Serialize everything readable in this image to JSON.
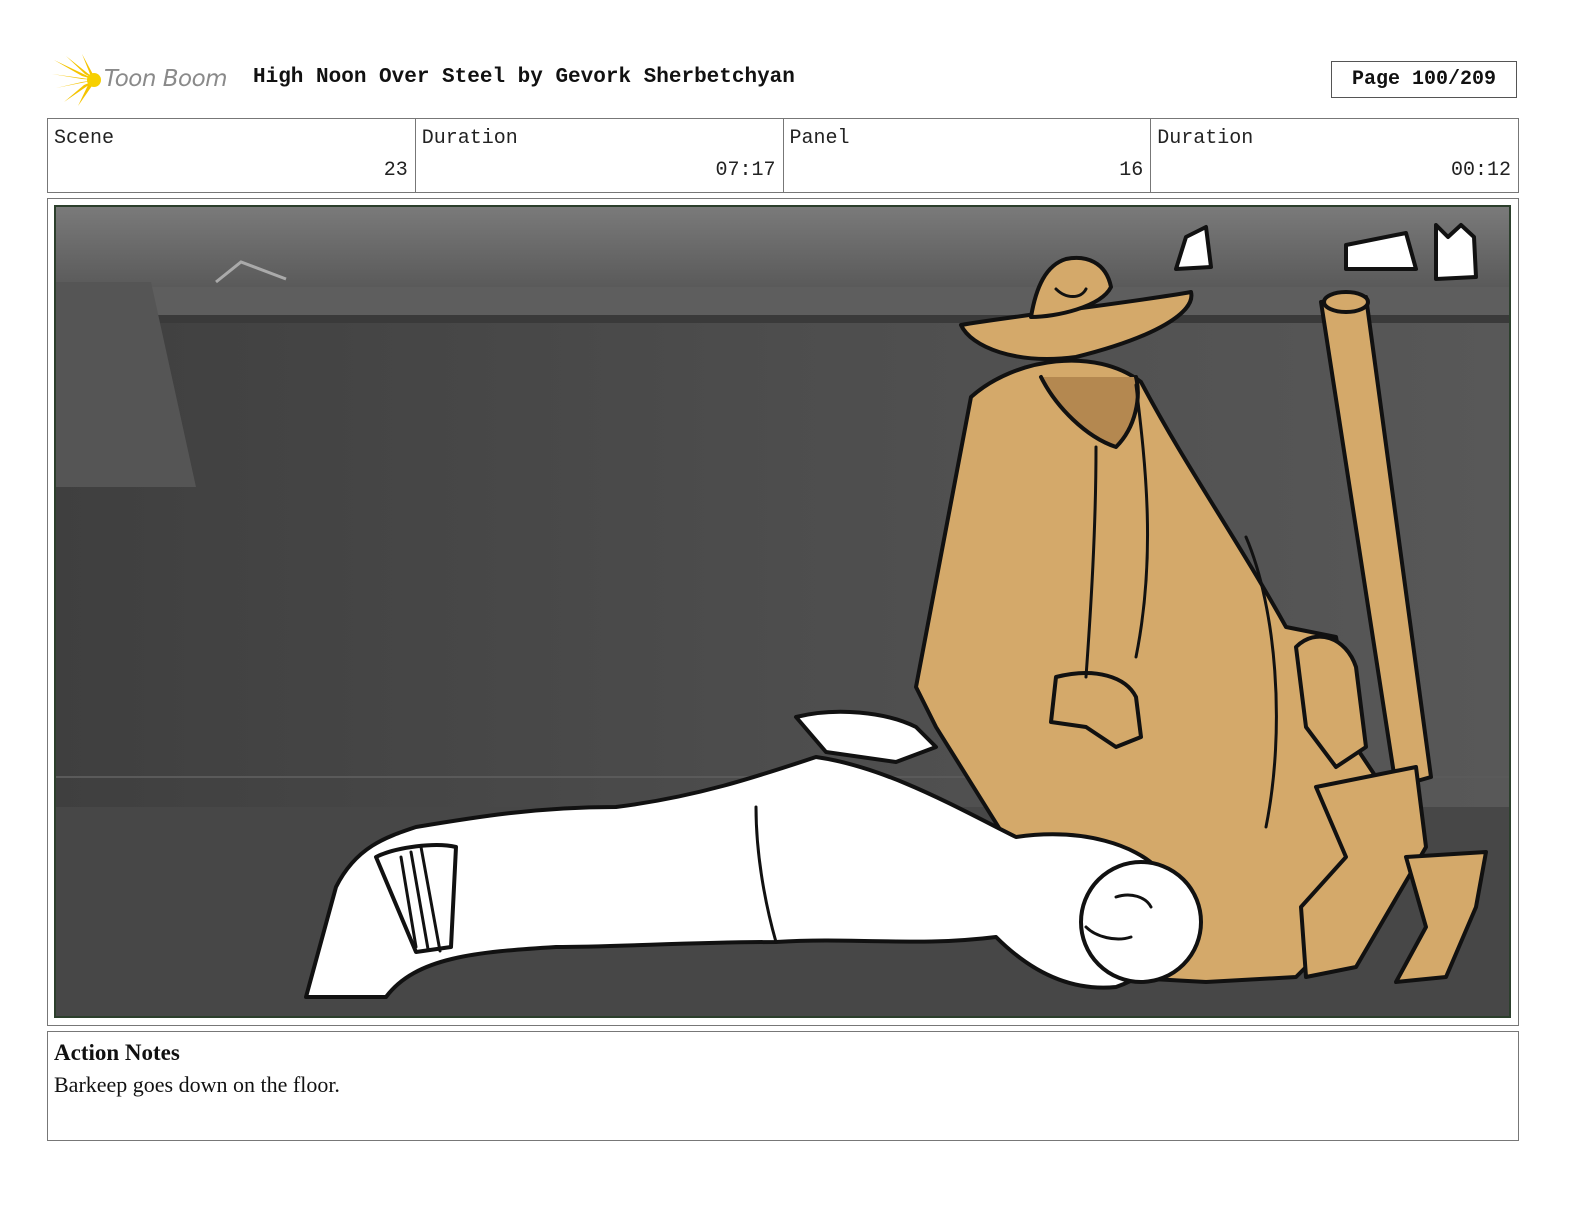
{
  "header": {
    "brand": "Toon Boom",
    "title": "High Noon Over Steel by Gevork Sherbetchyan",
    "page": "Page 100/209"
  },
  "info": [
    {
      "label": "Scene",
      "value": "23"
    },
    {
      "label": "Duration",
      "value": "07:17"
    },
    {
      "label": "Panel",
      "value": "16"
    },
    {
      "label": "Duration",
      "value": "00:12"
    }
  ],
  "panel": {
    "icon": "storyboard-drawing-icon",
    "colors": {
      "background": "#4e4e4e",
      "coat": "#d4a96a",
      "border": "#2c3f2c"
    }
  },
  "notes": {
    "title": "Action Notes",
    "text": "Barkeep goes down on the floor."
  },
  "logo_colors": {
    "burst": "#f5c400",
    "text": "#8a8a8a"
  }
}
